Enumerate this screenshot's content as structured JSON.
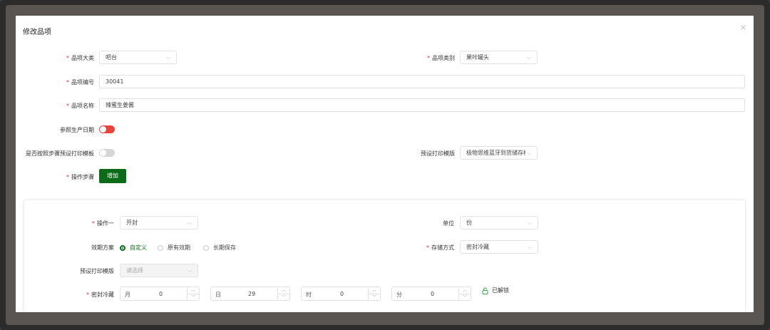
{
  "modal": {
    "title": "修改品项",
    "close_icon": "×"
  },
  "form": {
    "category": {
      "label": "品项大类",
      "value": "吧台"
    },
    "type": {
      "label": "品项类别",
      "value": "果咔罐头"
    },
    "code": {
      "label": "品项编号",
      "value": "30041"
    },
    "name": {
      "label": "品项名称",
      "value": "辣蜜生姜酱"
    },
    "ref_prod_date": {
      "label": "参照生产日期",
      "on": true
    },
    "use_step_template": {
      "label": "是否按照步骤预设打印模板",
      "on": false
    },
    "print_template": {
      "label": "预设打印模版",
      "value": "极物思维蓝牙到货储存标"
    },
    "steps": {
      "label": "操作步骤",
      "add_label": "增加"
    }
  },
  "step": {
    "op": {
      "label": "操作一",
      "value": "开封"
    },
    "unit": {
      "label": "单位",
      "value": "份"
    },
    "validity": {
      "label": "效期方案",
      "options": [
        "自定义",
        "原有效期",
        "长期保存"
      ],
      "selected": 0
    },
    "storage": {
      "label": "存储方式",
      "value": "密封冷藏"
    },
    "print_template": {
      "label": "预设打印模版",
      "placeholder": "请选择"
    },
    "sealed": {
      "label": "密封冷藏",
      "fields": [
        {
          "prefix": "月",
          "value": "0"
        },
        {
          "prefix": "日",
          "value": "29"
        },
        {
          "prefix": "时",
          "value": "0"
        },
        {
          "prefix": "分",
          "value": "0"
        }
      ]
    },
    "lock_label": "已解锁"
  }
}
